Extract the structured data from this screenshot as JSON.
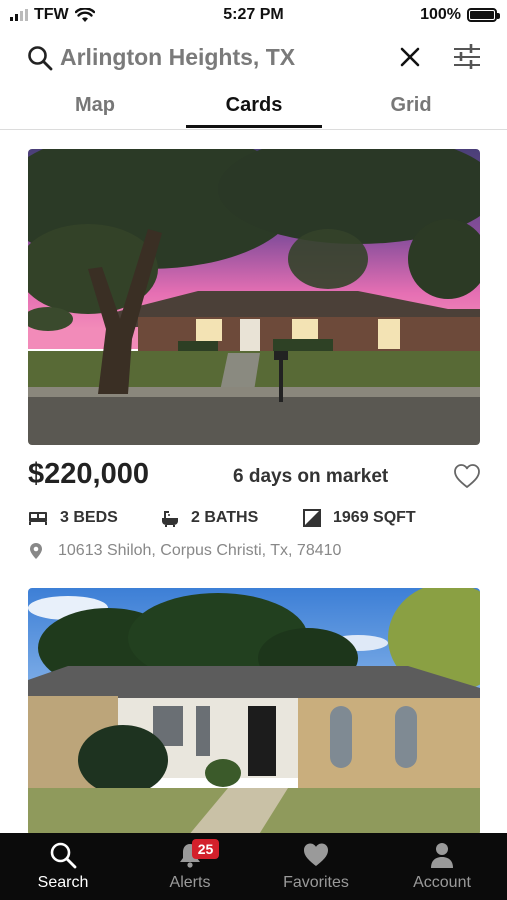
{
  "status_bar": {
    "carrier": "TFW",
    "time": "5:27 PM",
    "battery": "100%"
  },
  "search": {
    "query": "Arlington Heights, TX"
  },
  "tabs": [
    {
      "label": "Map",
      "active": false
    },
    {
      "label": "Cards",
      "active": true
    },
    {
      "label": "Grid",
      "active": false
    }
  ],
  "listings": [
    {
      "price": "$220,000",
      "days_on_market": "6 days on market",
      "beds": "3 BEDS",
      "baths": "2 BATHS",
      "sqft": "1969 SQFT",
      "address": "10613 Shiloh, Corpus Christi, Tx, 78410",
      "favorited": false
    }
  ],
  "tab_bar": {
    "items": [
      {
        "label": "Search",
        "icon": "search-icon",
        "active": true
      },
      {
        "label": "Alerts",
        "icon": "bell-icon",
        "active": false,
        "badge": "25"
      },
      {
        "label": "Favorites",
        "icon": "heart-icon",
        "active": false
      },
      {
        "label": "Account",
        "icon": "person-icon",
        "active": false
      }
    ]
  },
  "colors": {
    "accent": "#111111",
    "badge": "#d3202b",
    "tab_bar_bg": "#0b0b0b"
  }
}
